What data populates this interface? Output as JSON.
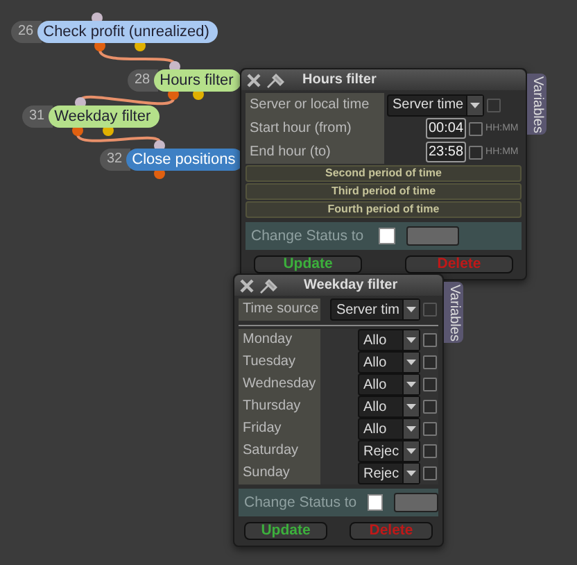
{
  "nodes": [
    {
      "number": "26",
      "label": "Check profit (unrealized)",
      "color": "#a9c9f2"
    },
    {
      "number": "28",
      "label": "Hours filter",
      "color": "#b5e08a"
    },
    {
      "number": "31",
      "label": "Weekday filter",
      "color": "#b5e08a"
    },
    {
      "number": "32",
      "label": "Close positions",
      "color": "#3e80c4"
    }
  ],
  "hours_window": {
    "title": "Hours filter",
    "side_tab": "Variables",
    "rows": [
      {
        "kind": "select",
        "label": "Server or local time",
        "value": "Server time",
        "checked": false
      },
      {
        "kind": "time",
        "label": "Start hour (from)",
        "value": "00:04",
        "hint": "HH:MM",
        "checked": false
      },
      {
        "kind": "time",
        "label": "End hour (to)",
        "value": "23:58",
        "hint": "HH:MM",
        "checked": false
      }
    ],
    "sections": [
      "Second period of time",
      "Third period of time",
      "Fourth period of time"
    ],
    "change_status": {
      "label": "Change Status to",
      "checked": false
    },
    "buttons": [
      {
        "label": "Update",
        "color": "#3cb03c"
      },
      {
        "label": "Delete",
        "color": "#c01818"
      }
    ]
  },
  "weekday_window": {
    "title": "Weekday filter",
    "side_tab": "Variables",
    "time_source": {
      "label": "Time source",
      "value": "Server tim",
      "checked": false
    },
    "days": [
      {
        "label": "Monday",
        "value": "Allo",
        "checked": false
      },
      {
        "label": "Tuesday",
        "value": "Allo",
        "checked": false
      },
      {
        "label": "Wednesday",
        "value": "Allo",
        "checked": false
      },
      {
        "label": "Thursday",
        "value": "Allo",
        "checked": false
      },
      {
        "label": "Friday",
        "value": "Allo",
        "checked": false
      },
      {
        "label": "Saturday",
        "value": "Rejec",
        "checked": false
      },
      {
        "label": "Sunday",
        "value": "Rejec",
        "checked": false
      }
    ],
    "change_status": {
      "label": "Change Status to",
      "checked": false
    },
    "buttons": [
      {
        "label": "Update",
        "color": "#3cb03c"
      },
      {
        "label": "Delete",
        "color": "#c01818"
      }
    ]
  }
}
